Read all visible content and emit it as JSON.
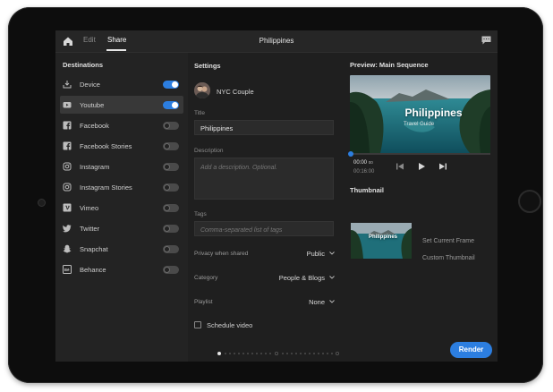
{
  "topbar": {
    "edit_tab": "Edit",
    "share_tab": "Share",
    "title": "Philippines"
  },
  "destinations": {
    "heading": "Destinations",
    "items": [
      {
        "label": "Device",
        "icon": "device-export-icon",
        "enabled": true,
        "selected": false
      },
      {
        "label": "Youtube",
        "icon": "youtube-icon",
        "enabled": true,
        "selected": true
      },
      {
        "label": "Facebook",
        "icon": "facebook-icon",
        "enabled": false,
        "selected": false
      },
      {
        "label": "Facebook Stories",
        "icon": "facebook-icon",
        "enabled": false,
        "selected": false
      },
      {
        "label": "Instagram",
        "icon": "instagram-icon",
        "enabled": false,
        "selected": false
      },
      {
        "label": "Instagram Stories",
        "icon": "instagram-icon",
        "enabled": false,
        "selected": false
      },
      {
        "label": "Vimeo",
        "icon": "vimeo-icon",
        "enabled": false,
        "selected": false
      },
      {
        "label": "Twitter",
        "icon": "twitter-icon",
        "enabled": false,
        "selected": false
      },
      {
        "label": "Snapchat",
        "icon": "snapchat-icon",
        "enabled": false,
        "selected": false
      },
      {
        "label": "Behance",
        "icon": "behance-icon",
        "enabled": false,
        "selected": false
      }
    ]
  },
  "settings": {
    "heading": "Settings",
    "account_name": "NYC Couple",
    "title_label": "Title",
    "title_value": "Philippines",
    "description_label": "Description",
    "description_placeholder": "Add a description. Optional.",
    "tags_label": "Tags",
    "tags_placeholder": "Comma-separated list of tags",
    "privacy_label": "Privacy when shared",
    "privacy_value": "Public",
    "category_label": "Category",
    "category_value": "People & Blogs",
    "playlist_label": "Playlist",
    "playlist_value": "None",
    "schedule_label": "Schedule video"
  },
  "preview": {
    "heading": "Preview: Main Sequence",
    "video_title": "Philippines",
    "video_subtitle": "Travel Guide",
    "current_time": "00:00",
    "current_frames": "00",
    "duration": "00:16:00"
  },
  "thumbnail": {
    "heading": "Thumbnail",
    "thumb_title": "Philippines",
    "set_current_frame": "Set Current Frame",
    "custom_thumbnail": "Custom Thumbnail"
  },
  "footer": {
    "render_label": "Render"
  },
  "colors": {
    "accent": "#2c7ee0",
    "background": "#1f1f1f",
    "panel": "#232323"
  }
}
